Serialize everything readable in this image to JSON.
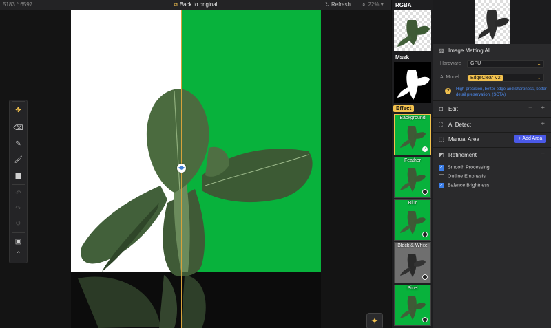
{
  "topbar": {
    "dimensions": "5183 * 6597",
    "back_label": "Back to original",
    "refresh_label": "Refresh",
    "zoom": "22%"
  },
  "previews": {
    "rgba_label": "RGBA",
    "mask_label": "Mask"
  },
  "effects": {
    "tag": "Effect",
    "items": [
      {
        "name": "Background",
        "selected": true
      },
      {
        "name": "Feather",
        "selected": false
      },
      {
        "name": "Blur",
        "selected": false
      },
      {
        "name": "Black & White",
        "selected": false
      },
      {
        "name": "Pixel",
        "selected": false
      }
    ]
  },
  "panel": {
    "matting_title": "Image Matting AI",
    "hardware_label": "Hardware",
    "hardware_value": "GPU",
    "model_label": "AI Model",
    "model_value": "EdgeClear  V2",
    "model_hint": "High-precision, better edge and sharpness, better detail preservation. (SOTA)",
    "edit_title": "Edit",
    "ai_detect_title": "AI Detect",
    "manual_area_title": "Manual Area",
    "add_area_label": "Add Area",
    "refinement_title": "Refinement",
    "refinement_options": [
      {
        "label": "Smooth Processing",
        "checked": true
      },
      {
        "label": "Outline Emphasis",
        "checked": false
      },
      {
        "label": "Balance Brightness",
        "checked": true
      }
    ]
  },
  "colors": {
    "accent": "#f2c14e",
    "green_bg": "#08b23c",
    "primary_button": "#4a59e8",
    "checkbox_on": "#3b7ee8",
    "hint_text": "#4d8bf0"
  }
}
